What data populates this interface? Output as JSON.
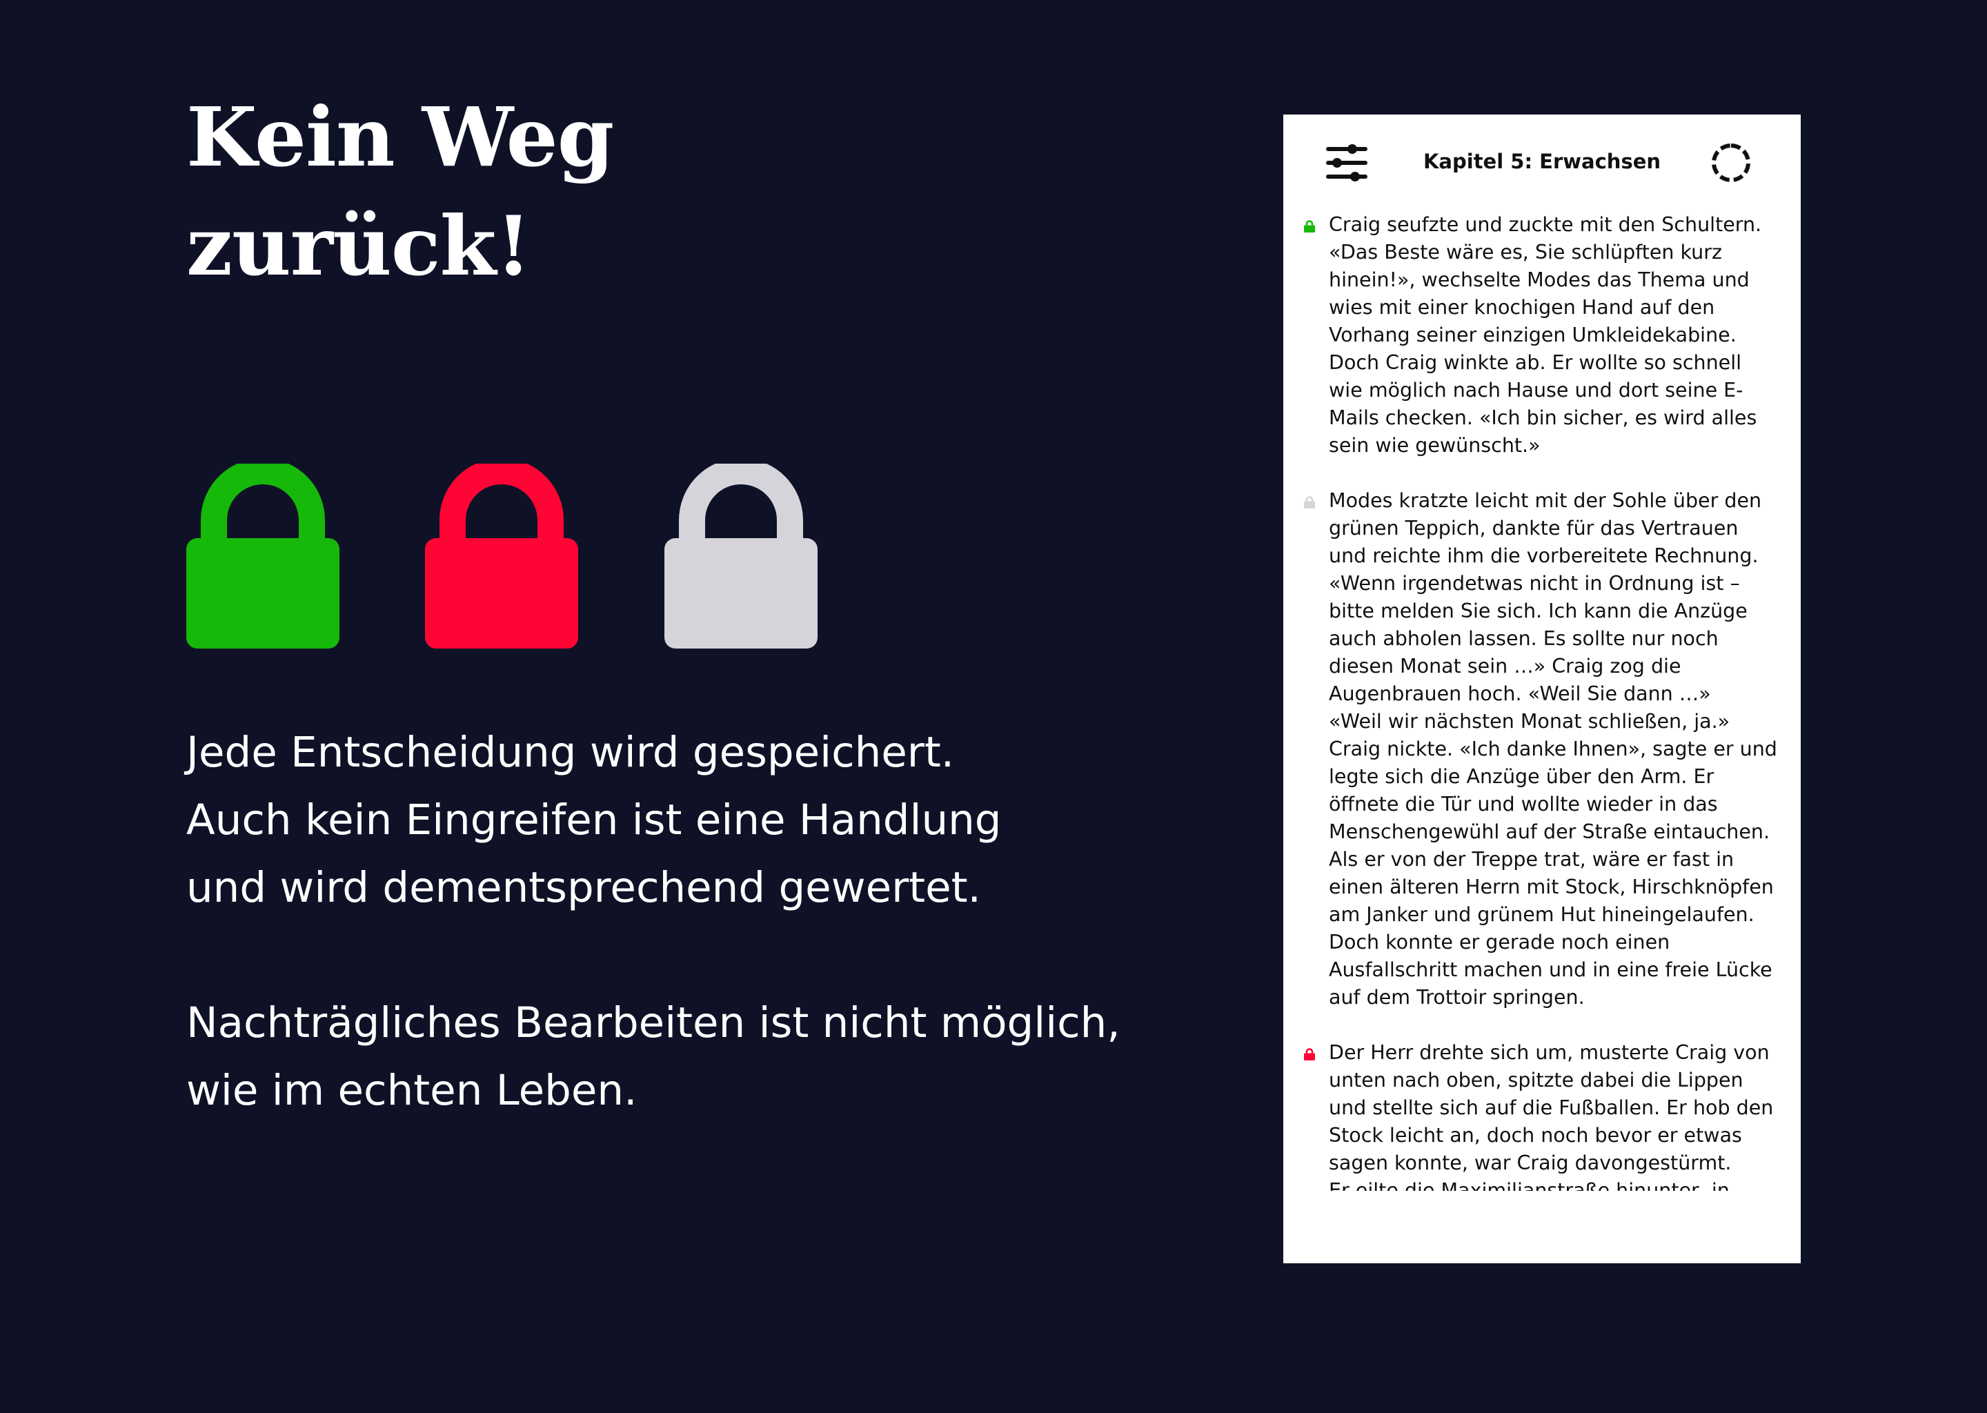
{
  "headline": {
    "lines": [
      "Kein Weg",
      "zurück!"
    ]
  },
  "locks": [
    {
      "name": "green-lock-icon",
      "icon": "lock",
      "color": "#16b80a"
    },
    {
      "name": "red-lock-icon",
      "icon": "lock",
      "color": "#ff0536"
    },
    {
      "name": "grey-lock-icon",
      "icon": "lock",
      "color": "#d5d4da"
    }
  ],
  "description": {
    "paragraph_1": [
      "Jede Entscheidung wird gespeichert.",
      "Auch kein Eingreifen ist eine Handlung",
      "und wird dementsprechend gewertet."
    ],
    "paragraph_2": [
      "Nachträgliches Bearbeiten ist nicht möglich,",
      "wie im echten Leben."
    ]
  },
  "reader": {
    "chapter_title": "Kapitel 5: Erwachsen",
    "settings_icon": "sliders-icon",
    "progress_icon": "progress-ring-icon",
    "paragraphs": [
      {
        "lock_color": "#16b80a",
        "lines": [
          "Craig seufzte und zuckte mit den Schultern.",
          "«Das Beste wäre es, Sie schlüpften kurz",
          "hinein!», wechselte Modes das Thema und",
          "wies mit einer knochigen Hand auf den",
          "Vorhang seiner einzigen Umkleidekabine.",
          "Doch Craig winkte ab. Er wollte so schnell",
          "wie möglich nach Hause und dort seine E-",
          "Mails checken. «Ich bin sicher, es wird alles",
          "sein wie gewünscht.»"
        ]
      },
      {
        "lock_color": "#d5d4da",
        "lines": [
          "Modes kratzte leicht mit der Sohle über den",
          "grünen Teppich, dankte für das Vertrauen",
          "und reichte ihm die vorbereitete Rechnung.",
          "«Wenn irgendetwas nicht in Ordnung ist –",
          "bitte melden Sie sich. Ich kann die Anzüge",
          "auch abholen lassen. Es sollte nur noch",
          "diesen Monat sein …» Craig zog die",
          "Augenbrauen hoch. «Weil Sie dann …»",
          "«Weil wir nächsten Monat schließen, ja.»",
          "Craig nickte. «Ich danke Ihnen», sagte er und",
          "legte sich die Anzüge über den Arm. Er",
          "öffnete die Tür und wollte wieder in das",
          "Menschengewühl auf der Straße eintauchen.",
          "Als er von der Treppe trat, wäre er fast in",
          "einen älteren Herrn mit Stock, Hirschknöpfen",
          "am Janker und grünem Hut hineingelaufen.",
          "Doch konnte er gerade noch einen",
          "Ausfallschritt machen und in eine freie Lücke",
          "auf dem Trottoir springen."
        ]
      },
      {
        "lock_color": "#ff0536",
        "lines": [
          "Der Herr drehte sich um, musterte Craig von",
          "unten nach oben, spitzte dabei die Lippen",
          "und stellte sich auf die Fußballen. Er hob den",
          "Stock leicht an, doch noch bevor er etwas",
          "sagen konnte, war Craig davongestürmt.",
          "Er eilte die Maximilianstraße hinunter, in"
        ]
      }
    ]
  },
  "colors": {
    "background": "#0f1227",
    "text_light": "#ffffff",
    "panel": "#ffffff",
    "text_dark": "#111111"
  }
}
